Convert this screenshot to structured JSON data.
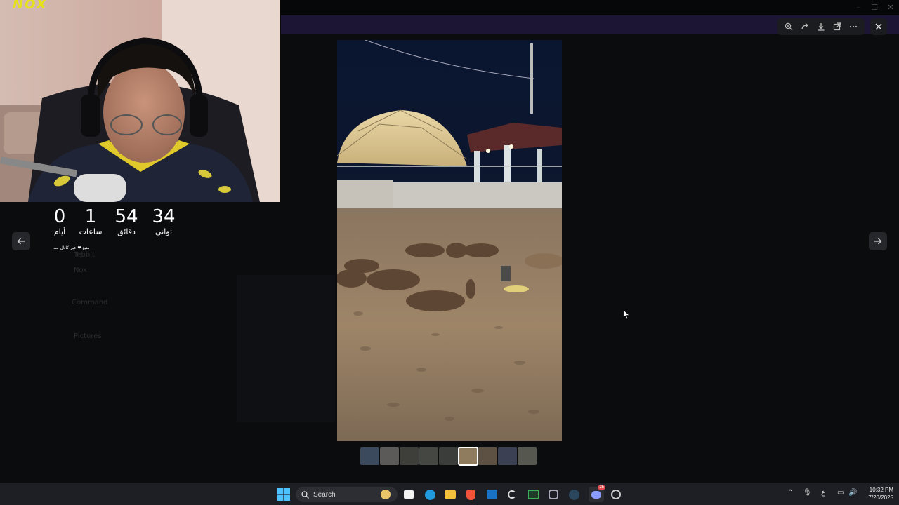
{
  "streamer": {
    "logo_text": "NOX"
  },
  "countdown": {
    "units": [
      {
        "value": "0",
        "label": "أيام"
      },
      {
        "value": "1",
        "label": "ساعات"
      },
      {
        "value": "54",
        "label": "دقائق"
      },
      {
        "value": "34",
        "label": "ثواني"
      }
    ],
    "note": "متبع ❤ عبر كاتال نب"
  },
  "background_app": {
    "channels": [
      "Tebbit",
      "Nox",
      "Command",
      "Pictures"
    ]
  },
  "viewer": {
    "toolbar_icons": [
      "zoom-in-icon",
      "forward-icon",
      "download-icon",
      "open-external-icon",
      "more-icon"
    ],
    "thumbnail_count": 9,
    "active_thumbnail": 6
  },
  "taskbar": {
    "search_label": "Search",
    "time": "10:32 PM",
    "date": "7/20/2025",
    "discord_badge": "25"
  },
  "colors": {
    "accent": "#e5e21a",
    "taskbar": "#1e1f24",
    "viewer_bg": "#0b0c0e"
  }
}
